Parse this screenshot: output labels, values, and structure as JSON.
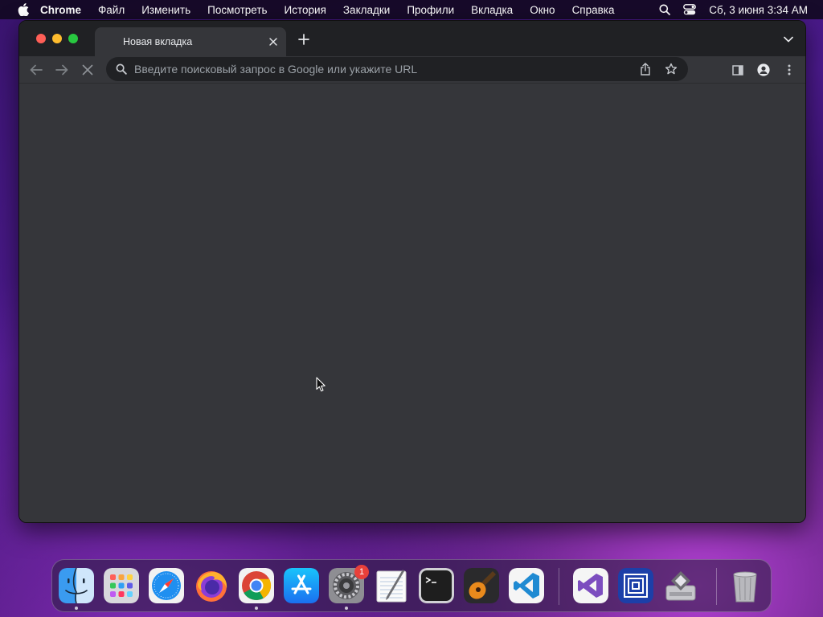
{
  "menubar": {
    "app_name": "Chrome",
    "items": [
      "Файл",
      "Изменить",
      "Посмотреть",
      "История",
      "Закладки",
      "Профили",
      "Вкладка",
      "Окно",
      "Справка"
    ],
    "clock": "Сб, 3 июня  3:34 AM"
  },
  "browser": {
    "tab_title": "Новая вкладка",
    "omnibox_placeholder": "Введите поисковый запрос в Google или укажите URL",
    "loading": true
  },
  "dock": {
    "apps": [
      "Finder",
      "Launchpad",
      "Safari",
      "Firefox",
      "Google Chrome",
      "App Store",
      "System Preferences",
      "TextEdit",
      "Terminal",
      "GarageBand",
      "Visual Studio Code",
      "Visual Studio",
      "Parallels",
      "Boot Camp Assistant",
      "Trash"
    ],
    "system_preferences_badge": "1"
  }
}
